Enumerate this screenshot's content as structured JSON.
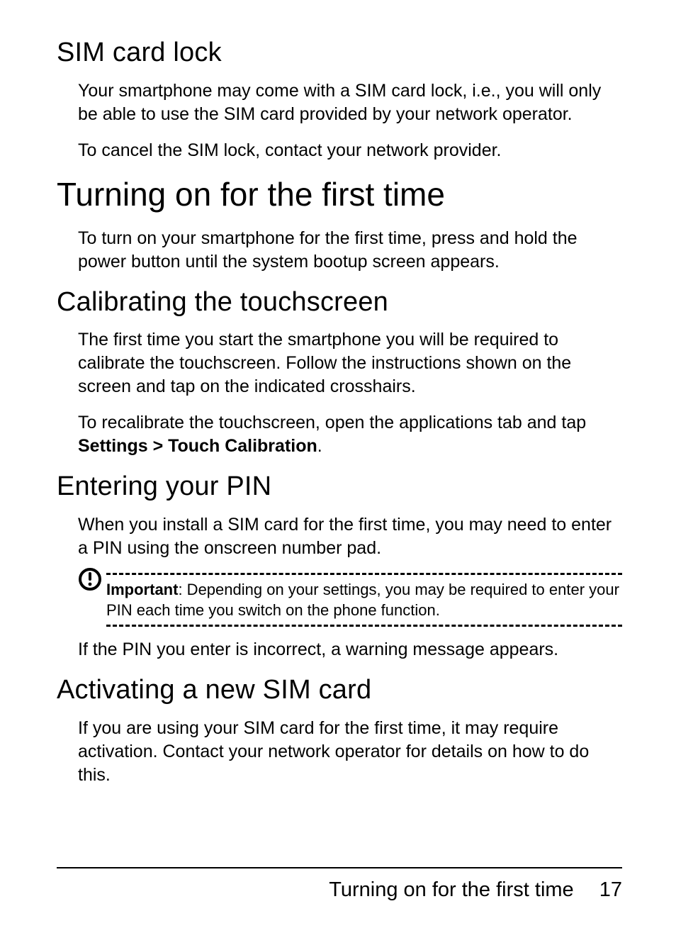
{
  "sections": {
    "sim_lock": {
      "heading": "SIM card lock",
      "p1": "Your smartphone may come with a SIM card lock, i.e., you will only be able to use the SIM card provided by your network operator.",
      "p2": "To cancel the SIM lock, contact your network provider."
    },
    "turning_on": {
      "heading": "Turning on for the first time",
      "p1": "To turn on your smartphone for the first time, press and hold the power button until the system bootup screen appears."
    },
    "calibrating": {
      "heading": "Calibrating the touchscreen",
      "p1": "The first time you start the smartphone you will be required to calibrate the touchscreen. Follow the instructions shown on the screen and tap on the indicated crosshairs.",
      "p2_pre": "To recalibrate the touchscreen, open the applications tab and tap ",
      "p2_bold": "Settings > Touch Calibration",
      "p2_post": "."
    },
    "pin": {
      "heading": "Entering your PIN",
      "p1": "When you install a SIM card for the first time, you may need to enter a PIN using the onscreen number pad.",
      "note_label": "Important",
      "note_text": ": Depending on your settings, you may be required to enter your PIN each time you switch on the phone function.",
      "p2": "If the PIN you enter is incorrect, a warning message appears."
    },
    "activating": {
      "heading": "Activating a new SIM card",
      "p1": "If you are using your SIM card for the first time, it may require activation. Contact your network operator for details on how to do this."
    }
  },
  "footer": {
    "title": "Turning on for the first time",
    "page_number": "17"
  }
}
